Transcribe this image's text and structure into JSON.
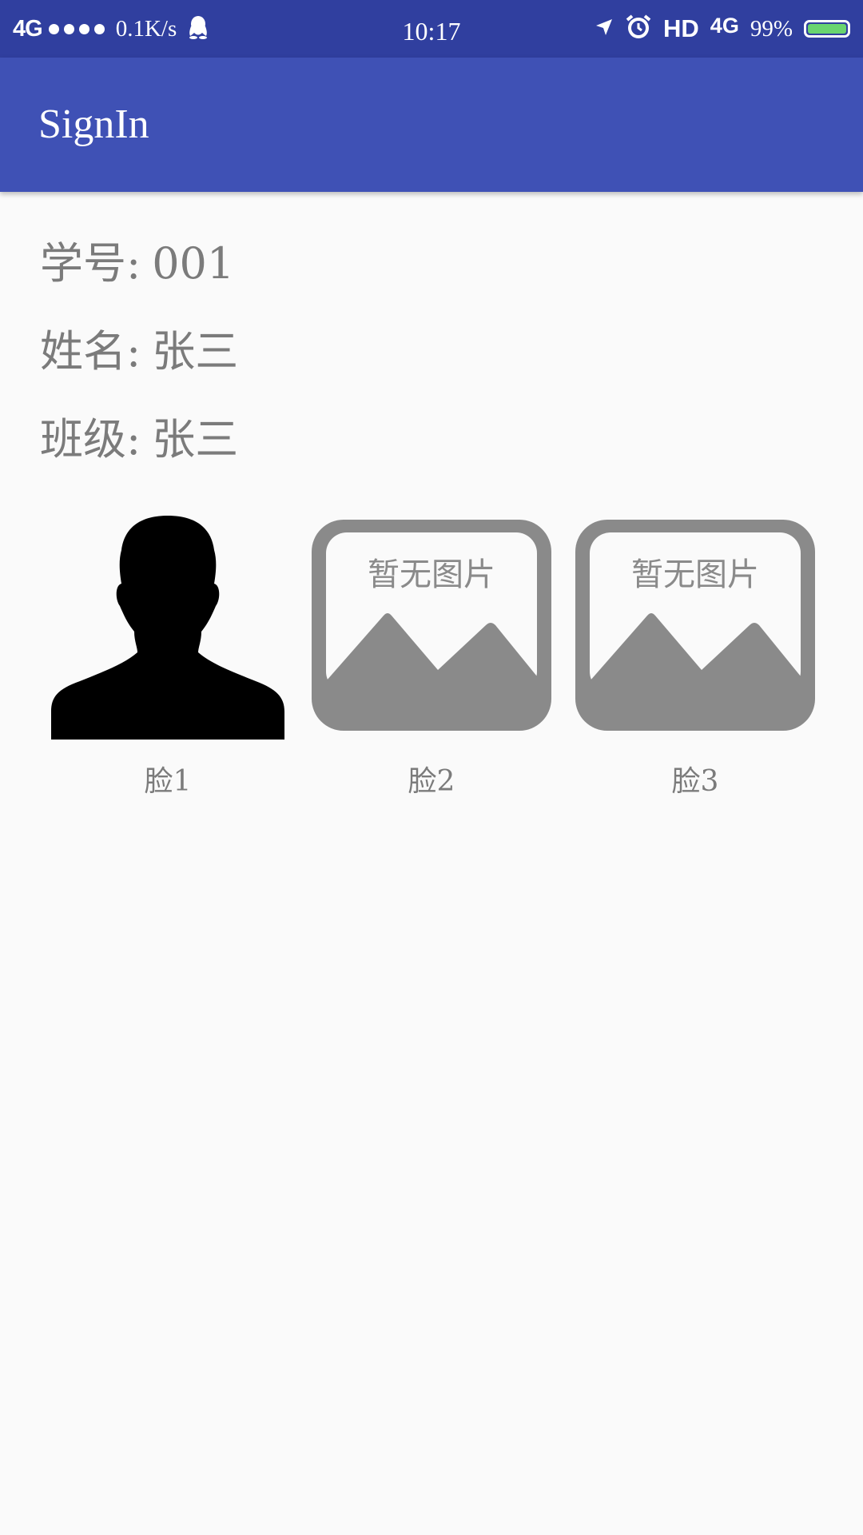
{
  "status_bar": {
    "network": "4G",
    "speed": "0.1K/s",
    "time": "10:17",
    "hd": "HD",
    "network_right": "4G",
    "battery": "99%",
    "battery_level": 0.99
  },
  "app_bar": {
    "title": "SignIn"
  },
  "student": {
    "id_label": "学号:",
    "id_value": "001",
    "name_label": "姓名:",
    "name_value": "张三",
    "class_label": "班级:",
    "class_value": "张三"
  },
  "faces": [
    {
      "label": "脸1",
      "icon": "person-silhouette-icon"
    },
    {
      "label": "脸2",
      "icon": "no-image-placeholder-icon",
      "placeholder_text": "暂无图片"
    },
    {
      "label": "脸3",
      "icon": "no-image-placeholder-icon",
      "placeholder_text": "暂无图片"
    }
  ],
  "colors": {
    "status_bar": "#303f9f",
    "app_bar": "#3f51b5",
    "background": "#fafafa",
    "text_gray": "#7b7b7b",
    "placeholder_gray": "#8a8a8a",
    "battery_fill": "#69d46f"
  }
}
